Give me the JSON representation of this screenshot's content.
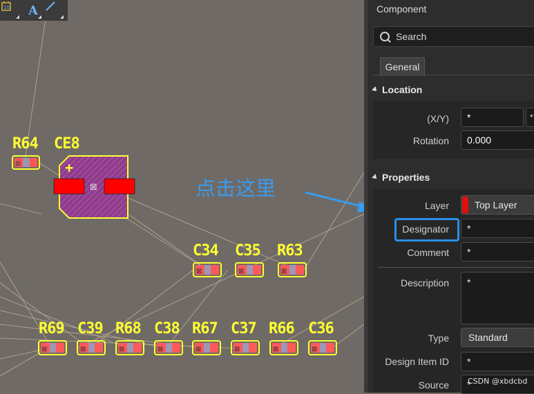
{
  "toolbar": {
    "icons": [
      "component-place-icon",
      "text-string-icon",
      "line-tool-icon"
    ],
    "text_icon_glyph": "A"
  },
  "canvas": {
    "designators": [
      "R64",
      "CE8",
      "C34",
      "C35",
      "R63",
      "R69",
      "C39",
      "R68",
      "C38",
      "R67",
      "C37",
      "R66",
      "C36"
    ],
    "plus_sign": "+"
  },
  "annotation": {
    "text": "点击这里",
    "color": "#3a9bf0"
  },
  "panel": {
    "title": "Component",
    "search_placeholder": "Search",
    "tab_general": "General",
    "location": {
      "header": "Location",
      "xy_label": "(X/Y)",
      "xy_value": "*",
      "xy_second_value": "*",
      "rotation_label": "Rotation",
      "rotation_value": "0.000"
    },
    "properties": {
      "header": "Properties",
      "layer_label": "Layer",
      "layer_value": "Top Layer",
      "layer_color": "#e01010",
      "designator_label": "Designator",
      "designator_value": "*",
      "comment_label": "Comment",
      "comment_value": "*",
      "description_label": "Description",
      "description_value": "*",
      "type_label": "Type",
      "type_value": "Standard",
      "design_item_id_label": "Design Item ID",
      "design_item_id_value": "*",
      "source_label": "Source",
      "source_value": "*"
    }
  },
  "watermark": "CSDN @xbdcbd",
  "colors": {
    "silkscreen": "#ffff33",
    "pad": "#ff0000",
    "canvas_bg": "#6f6a65",
    "panel_bg": "#2d2d2d",
    "highlight": "#2a8fe6"
  }
}
